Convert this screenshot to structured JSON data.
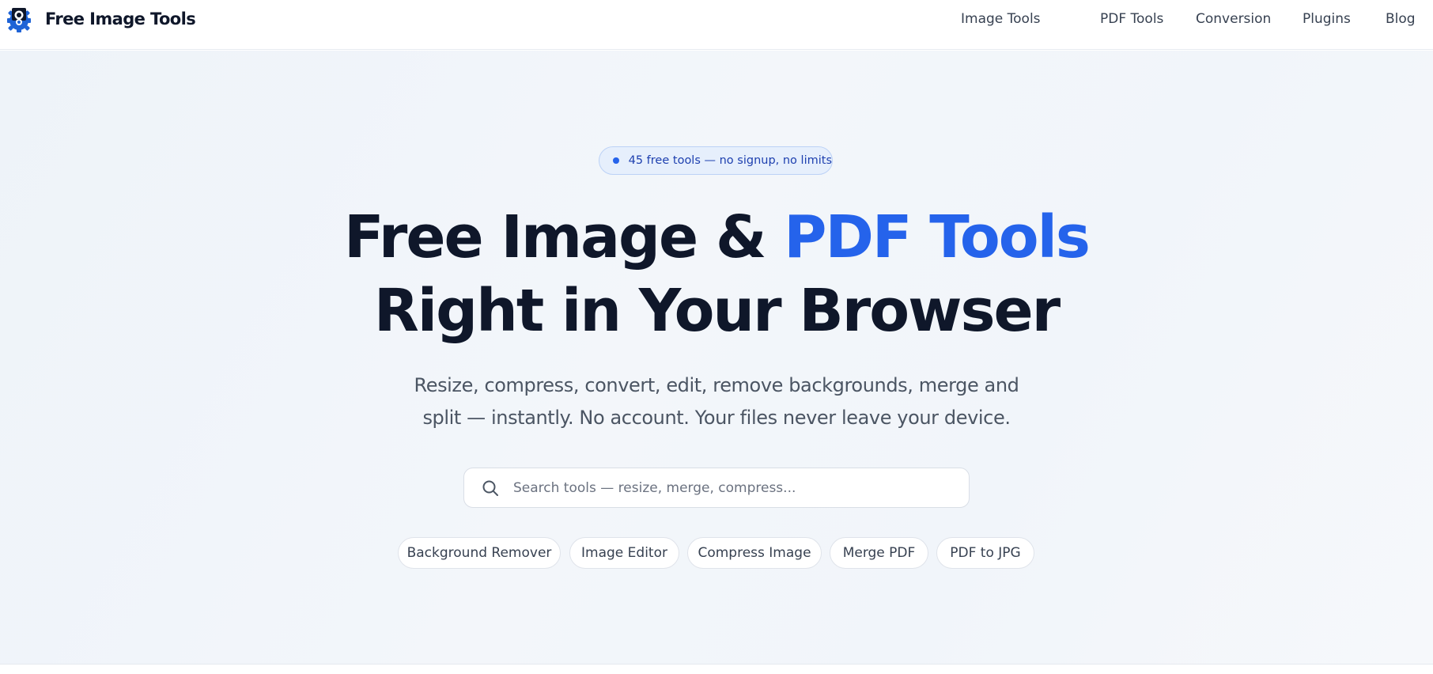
{
  "header": {
    "logo_text": "Free Image Tools",
    "logo_icon": "camera-robot-icon",
    "nav": [
      {
        "label": "Image Tools"
      },
      {
        "label": "PDF Tools"
      },
      {
        "label": "Conversion"
      },
      {
        "label": "Plugins"
      },
      {
        "label": "Blog"
      }
    ]
  },
  "hero": {
    "badge": "45 free tools — no signup, no limits",
    "headline_part1": "Free Image & ",
    "headline_accent": "PDF Tools",
    "headline_line2": "Right in Your Browser",
    "subtitle": "Resize, compress, convert, edit, remove backgrounds, merge and split — instantly. No account. Your files never leave your device.",
    "search": {
      "placeholder": "Search tools — resize, merge, compress...",
      "icon": "search-icon"
    },
    "quick_links": [
      {
        "label": "Background Remover"
      },
      {
        "label": "Image Editor"
      },
      {
        "label": "Compress Image"
      },
      {
        "label": "Merge PDF"
      },
      {
        "label": "PDF to JPG"
      }
    ]
  },
  "colors": {
    "accent": "#2563eb",
    "heading": "#0f172a",
    "body_text": "#4b5563",
    "badge_bg": "#e6effc"
  }
}
